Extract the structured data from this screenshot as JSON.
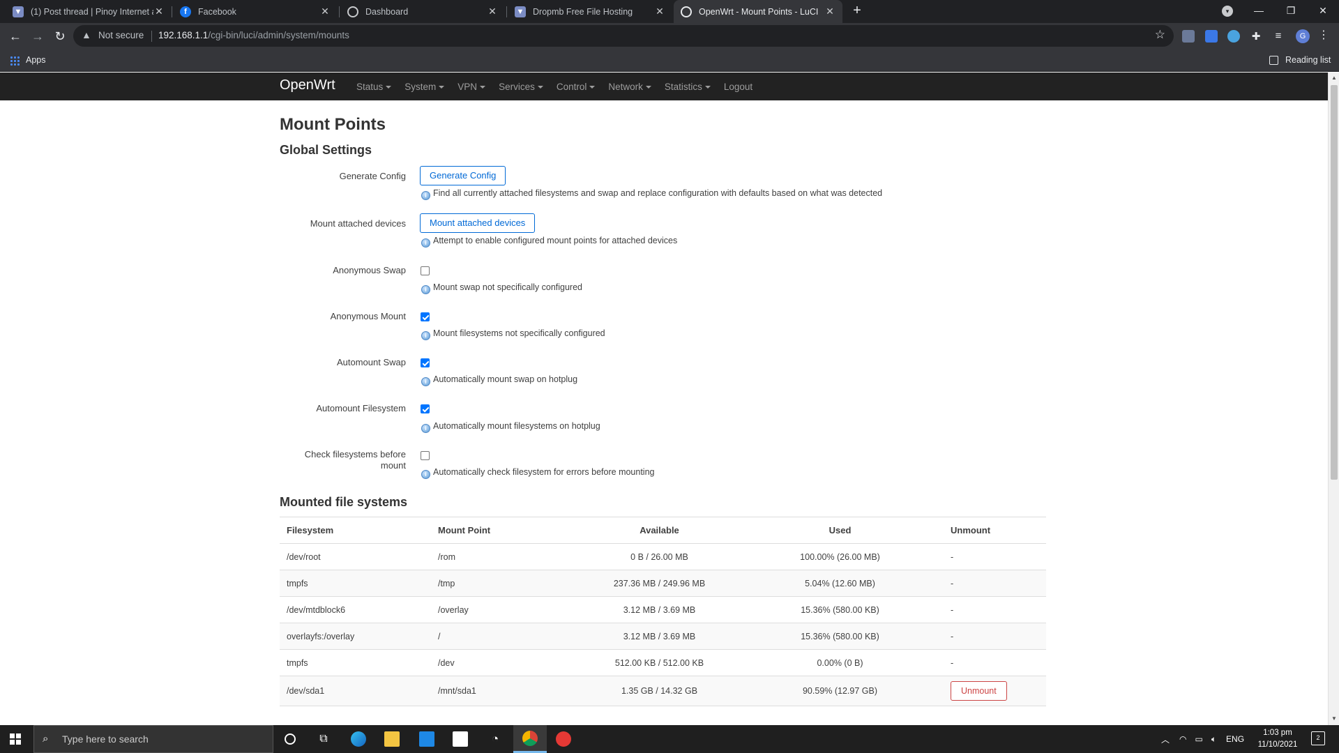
{
  "browser": {
    "tabs": [
      {
        "title": "(1) Post thread | Pinoy Internet a",
        "icon": "shield-icon",
        "active": false
      },
      {
        "title": "Facebook",
        "icon": "facebook-icon",
        "active": false
      },
      {
        "title": "Dashboard",
        "icon": "dashboard-icon",
        "active": false
      },
      {
        "title": "Dropmb Free File Hosting",
        "icon": "shield-icon",
        "active": false
      },
      {
        "title": "OpenWrt - Mount Points - LuCI",
        "icon": "globe-icon",
        "active": true
      }
    ],
    "address": {
      "security": "Not secure",
      "host": "192.168.1.1",
      "path": "/cgi-bin/luci/admin/system/mounts"
    },
    "bookmarks": {
      "apps_label": "Apps",
      "reading_list_label": "Reading list"
    },
    "profile_initial": "G"
  },
  "openwrt": {
    "brand": "OpenWrt",
    "menu": [
      "Status",
      "System",
      "VPN",
      "Services",
      "Control",
      "Network",
      "Statistics",
      "Logout"
    ]
  },
  "page": {
    "title": "Mount Points",
    "global_settings_title": "Global Settings",
    "settings": [
      {
        "label": "Generate Config",
        "type": "button",
        "button_label": "Generate Config",
        "hint": "Find all currently attached filesystems and swap and replace configuration with defaults based on what was detected"
      },
      {
        "label": "Mount attached devices",
        "type": "button",
        "button_label": "Mount attached devices",
        "hint": "Attempt to enable configured mount points for attached devices"
      },
      {
        "label": "Anonymous Swap",
        "type": "checkbox",
        "checked": false,
        "hint": "Mount swap not specifically configured"
      },
      {
        "label": "Anonymous Mount",
        "type": "checkbox",
        "checked": true,
        "hint": "Mount filesystems not specifically configured"
      },
      {
        "label": "Automount Swap",
        "type": "checkbox",
        "checked": true,
        "hint": "Automatically mount swap on hotplug"
      },
      {
        "label": "Automount Filesystem",
        "type": "checkbox",
        "checked": true,
        "hint": "Automatically mount filesystems on hotplug"
      },
      {
        "label": "Check filesystems before mount",
        "type": "checkbox",
        "checked": false,
        "hint": "Automatically check filesystem for errors before mounting"
      }
    ],
    "mounted_title": "Mounted file systems",
    "table": {
      "headers": [
        "Filesystem",
        "Mount Point",
        "Available",
        "Used",
        "Unmount"
      ],
      "rows": [
        [
          "/dev/root",
          "/rom",
          "0 B / 26.00 MB",
          "100.00% (26.00 MB)",
          "-"
        ],
        [
          "tmpfs",
          "/tmp",
          "237.36 MB / 249.96 MB",
          "5.04% (12.60 MB)",
          "-"
        ],
        [
          "/dev/mtdblock6",
          "/overlay",
          "3.12 MB / 3.69 MB",
          "15.36% (580.00 KB)",
          "-"
        ],
        [
          "overlayfs:/overlay",
          "/",
          "3.12 MB / 3.69 MB",
          "15.36% (580.00 KB)",
          "-"
        ],
        [
          "tmpfs",
          "/dev",
          "512.00 KB / 512.00 KB",
          "0.00% (0 B)",
          "-"
        ],
        [
          "/dev/sda1",
          "/mnt/sda1",
          "1.35 GB / 14.32 GB",
          "90.59% (12.97 GB)",
          "Unmount"
        ]
      ]
    }
  },
  "taskbar": {
    "search_placeholder": "Type here to search",
    "language": "ENG",
    "time": "1:03 pm",
    "date": "11/10/2021",
    "notification_count": "2"
  }
}
